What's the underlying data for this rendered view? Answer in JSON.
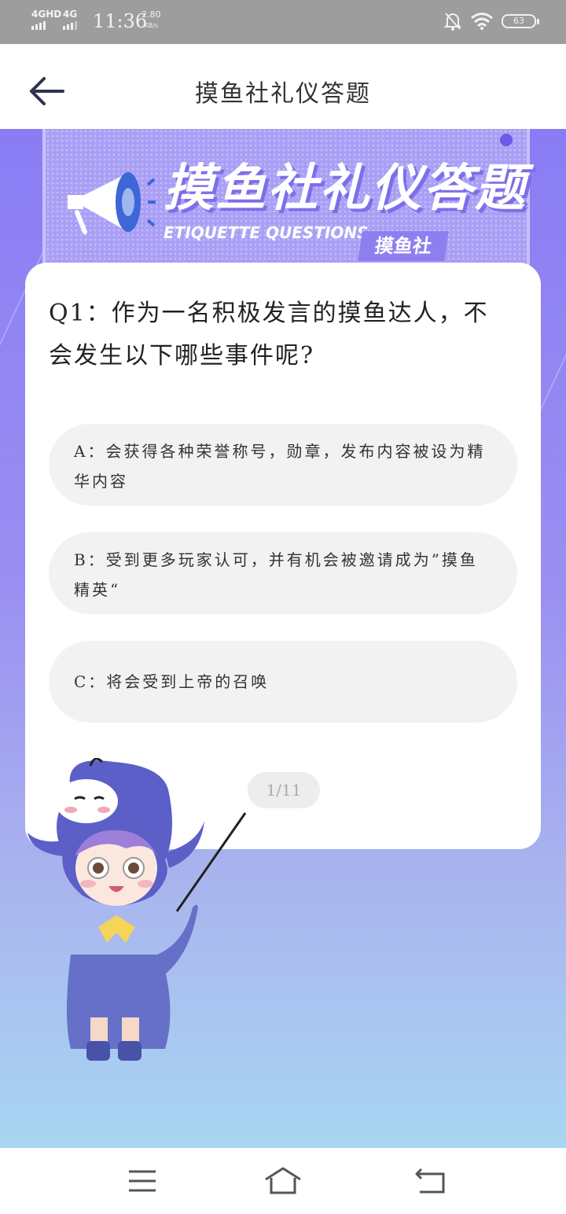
{
  "status_bar": {
    "network_1": "4GHD",
    "network_2": "4G",
    "time": "11:36",
    "speed_value": "2.80",
    "speed_unit": "KB/s",
    "battery": "63"
  },
  "header": {
    "title": "摸鱼社礼仪答题"
  },
  "banner": {
    "title": "摸鱼社礼仪答题",
    "subtitle": "ETIQUETTE QUESTIONS",
    "tag": "摸鱼社"
  },
  "quiz": {
    "question": "Q1：作为一名积极发言的摸鱼达人，不会发生以下哪些事件呢?",
    "options": [
      {
        "label": "A：会获得各种荣誉称号，勋章，发布内容被设为精华内容"
      },
      {
        "label": "B：受到更多玩家认可，并有机会被邀请成为”摸鱼精英“"
      },
      {
        "label": "C：将会受到上帝的召唤"
      }
    ],
    "progress": "1/11"
  },
  "icons": {
    "back": "arrow-left-icon",
    "menu": "menu-icon",
    "home": "home-icon",
    "return": "return-icon"
  },
  "colors": {
    "accent": "#8a7cf4",
    "option_bg": "#f2f2f2",
    "status_bar": "#9d9d9d"
  }
}
